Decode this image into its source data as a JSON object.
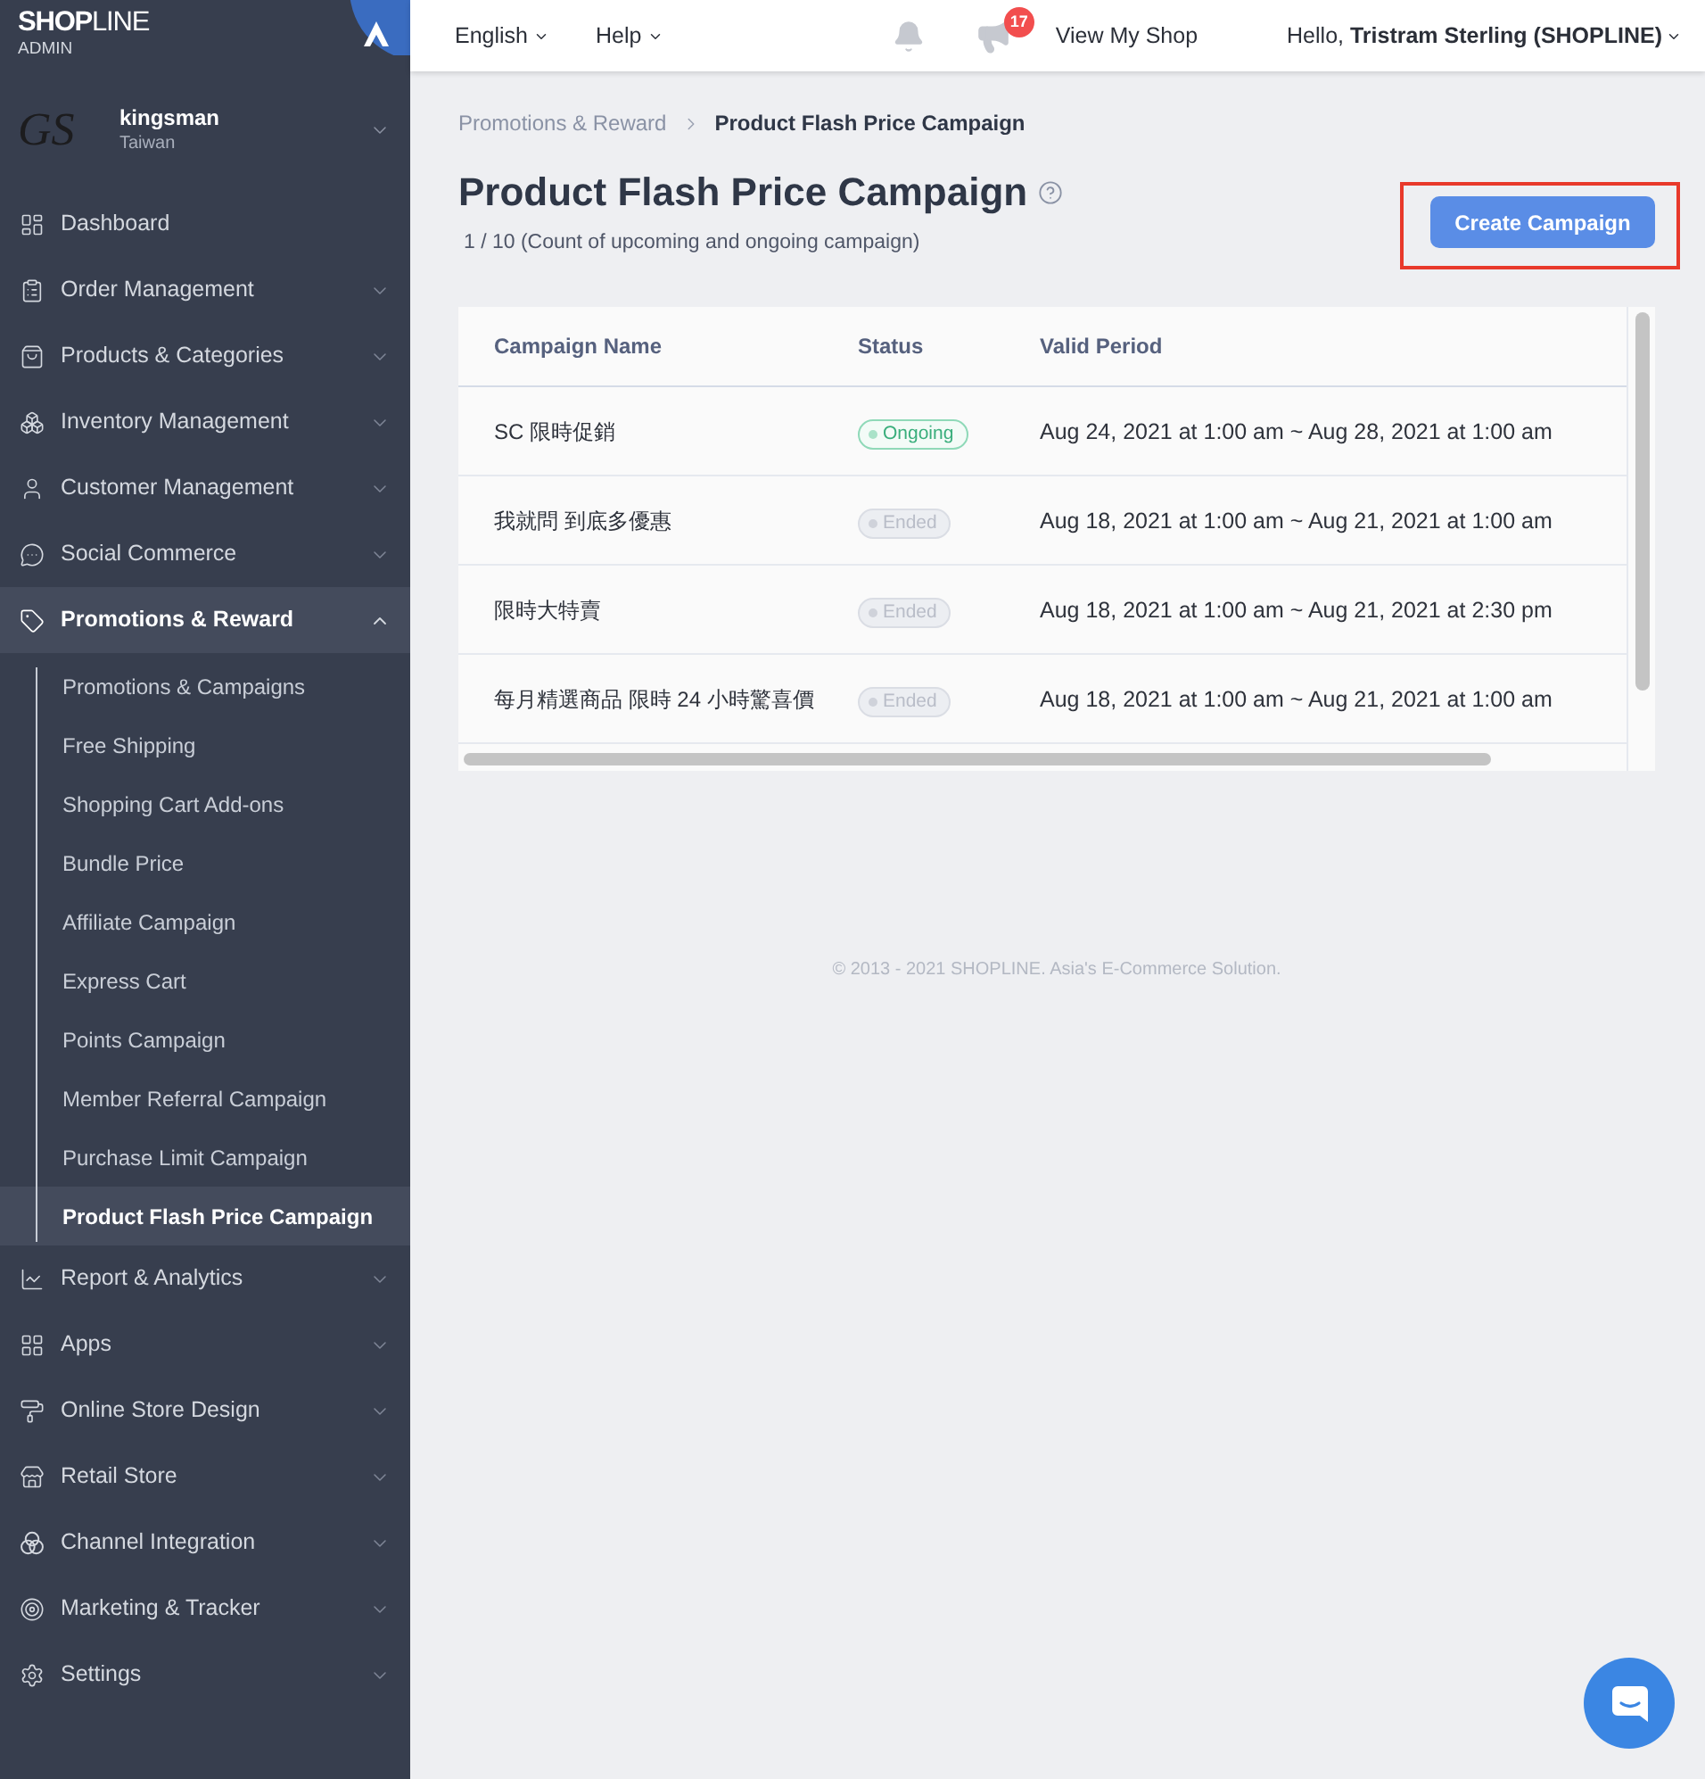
{
  "sidebar": {
    "brand": {
      "name": "**SHOP**LINE",
      "tagline": "ADMIN"
    },
    "store": {
      "logo_text": "GS",
      "name": "kingsman",
      "region": "Taiwan"
    },
    "items": [
      {
        "label": "Dashboard",
        "kind": "link",
        "expanded": false
      },
      {
        "label": "Order Management",
        "kind": "group",
        "expanded": false
      },
      {
        "label": "Products & Categories",
        "kind": "group",
        "expanded": false
      },
      {
        "label": "Inventory Management",
        "kind": "group",
        "expanded": false
      },
      {
        "label": "Customer Management",
        "kind": "group",
        "expanded": false
      },
      {
        "label": "Social Commerce",
        "kind": "group",
        "expanded": false
      },
      {
        "label": "Promotions & Reward",
        "kind": "group",
        "expanded": true,
        "children": [
          {
            "label": "Promotions & Campaigns",
            "selected": false
          },
          {
            "label": "Free Shipping",
            "selected": false
          },
          {
            "label": "Shopping Cart Add-ons",
            "selected": false
          },
          {
            "label": "Bundle Price",
            "selected": false
          },
          {
            "label": "Affiliate Campaign",
            "selected": false
          },
          {
            "label": "Express Cart",
            "selected": false
          },
          {
            "label": "Points Campaign",
            "selected": false
          },
          {
            "label": "Member Referral Campaign",
            "selected": false
          },
          {
            "label": "Purchase Limit Campaign",
            "selected": false
          },
          {
            "label": "Product Flash Price Campaign",
            "selected": true
          }
        ]
      },
      {
        "label": "Report & Analytics",
        "kind": "group",
        "expanded": false
      },
      {
        "label": "Apps",
        "kind": "group",
        "expanded": false
      },
      {
        "label": "Online Store Design",
        "kind": "group",
        "expanded": false
      },
      {
        "label": "Retail Store",
        "kind": "group",
        "expanded": false
      },
      {
        "label": "Channel Integration",
        "kind": "group",
        "expanded": false
      },
      {
        "label": "Marketing & Tracker",
        "kind": "group",
        "expanded": false
      },
      {
        "label": "Settings",
        "kind": "group",
        "expanded": false
      }
    ]
  },
  "topbar": {
    "language": "English",
    "help": "Help",
    "notification_count": "17",
    "view_shop": "View My Shop",
    "greeting": "Hello, **Tristram Sterling (SHOPLINE)**"
  },
  "page": {
    "breadcrumb": [
      {
        "label": "Promotions & Reward",
        "current": false
      },
      {
        "label": "Product Flash Price Campaign",
        "current": true
      }
    ],
    "title": "Product Flash Price Campaign",
    "subtitle": "1 / 10 (Count of upcoming and ongoing campaign)",
    "create_button": {
      "label": "Create Campaign",
      "highlighted": true
    }
  },
  "table": {
    "columns": [
      "Campaign Name",
      "Status",
      "Valid Period"
    ],
    "rows": [
      {
        "name": "SC 限時促銷",
        "status": {
          "label": "Ongoing",
          "kind": "ongoing"
        },
        "period": "Aug 24, 2021 at 1:00 am ~ Aug 28, 2021 at 1:00 am"
      },
      {
        "name": "我就問 到底多優惠",
        "status": {
          "label": "Ended",
          "kind": "ended"
        },
        "period": "Aug 18, 2021 at 1:00 am ~ Aug 21, 2021 at 1:00 am"
      },
      {
        "name": "限時大特賣",
        "status": {
          "label": "Ended",
          "kind": "ended"
        },
        "period": "Aug 18, 2021 at 1:00 am ~ Aug 21, 2021 at 2:30 pm"
      },
      {
        "name": "每月精選商品 限時 24 小時驚喜價",
        "status": {
          "label": "Ended",
          "kind": "ended"
        },
        "period": "Aug 18, 2021 at 1:00 am ~ Aug 21, 2021 at 1:00 am"
      }
    ]
  },
  "footer": "© 2013 - 2021 SHOPLINE. Asia's E-Commerce Solution."
}
